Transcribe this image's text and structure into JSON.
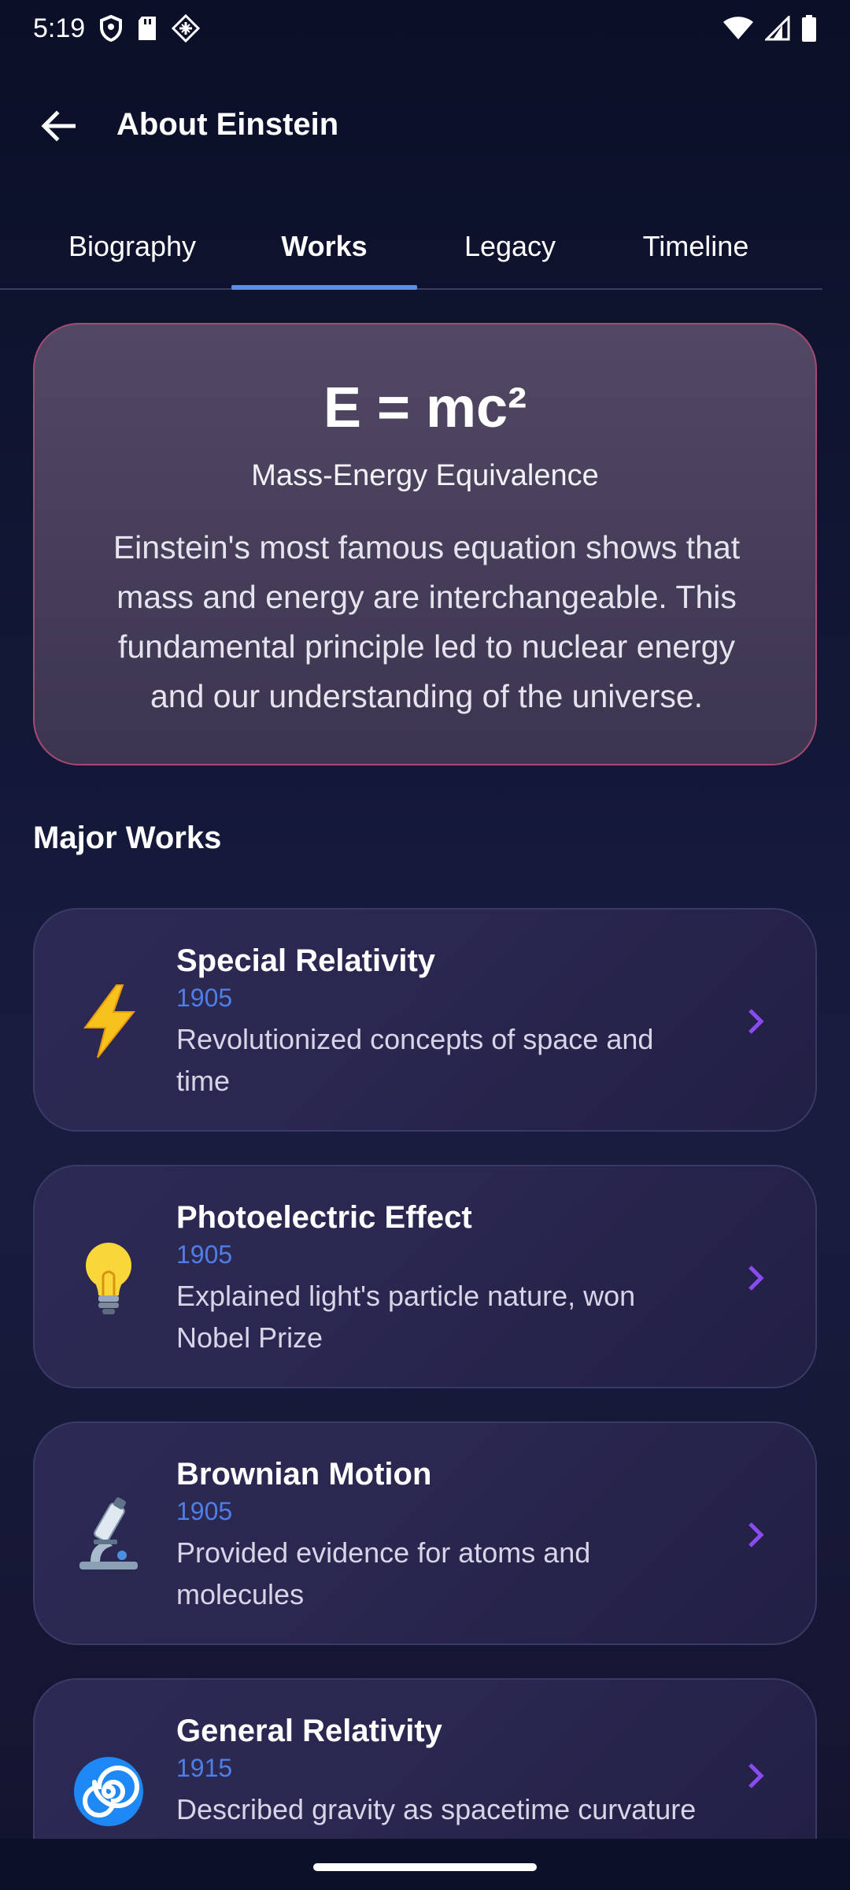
{
  "status_bar": {
    "time": "5:19",
    "icons_left": [
      "shield-icon",
      "sd-card-icon",
      "diamond-grid-icon"
    ],
    "icons_right": [
      "wifi-icon",
      "signal-icon",
      "battery-icon"
    ]
  },
  "app_bar": {
    "back_icon": "arrow-left-icon",
    "title": "About Einstein"
  },
  "tabs": [
    {
      "label": "Biography",
      "active": false
    },
    {
      "label": "Works",
      "active": true
    },
    {
      "label": "Legacy",
      "active": false
    },
    {
      "label": "Timeline",
      "active": false
    }
  ],
  "feature": {
    "equation": "E = mc²",
    "subtitle": "Mass-Energy Equivalence",
    "description": "Einstein's most famous equation shows that mass and energy are interchangeable. This fundamental principle led to nuclear energy and our understanding of the universe."
  },
  "major_works": {
    "heading": "Major Works",
    "items": [
      {
        "icon": "lightning-icon",
        "title": "Special Relativity",
        "year": "1905",
        "description": "Revolutionized concepts of space and time"
      },
      {
        "icon": "lightbulb-icon",
        "title": "Photoelectric Effect",
        "year": "1905",
        "description": "Explained light's particle nature, won Nobel Prize"
      },
      {
        "icon": "microscope-icon",
        "title": "Brownian Motion",
        "year": "1905",
        "description": "Provided evidence for atoms and molecules"
      },
      {
        "icon": "spiral-icon",
        "title": "General Relativity",
        "year": "1915",
        "description": "Described gravity as spacetime curvature"
      }
    ]
  },
  "colors": {
    "background": "#0c1028",
    "accent_blue": "#5b8df2",
    "year_blue": "#4f7fe6",
    "chevron_purple": "#8a4cf0",
    "feature_border": "#a54a73"
  }
}
